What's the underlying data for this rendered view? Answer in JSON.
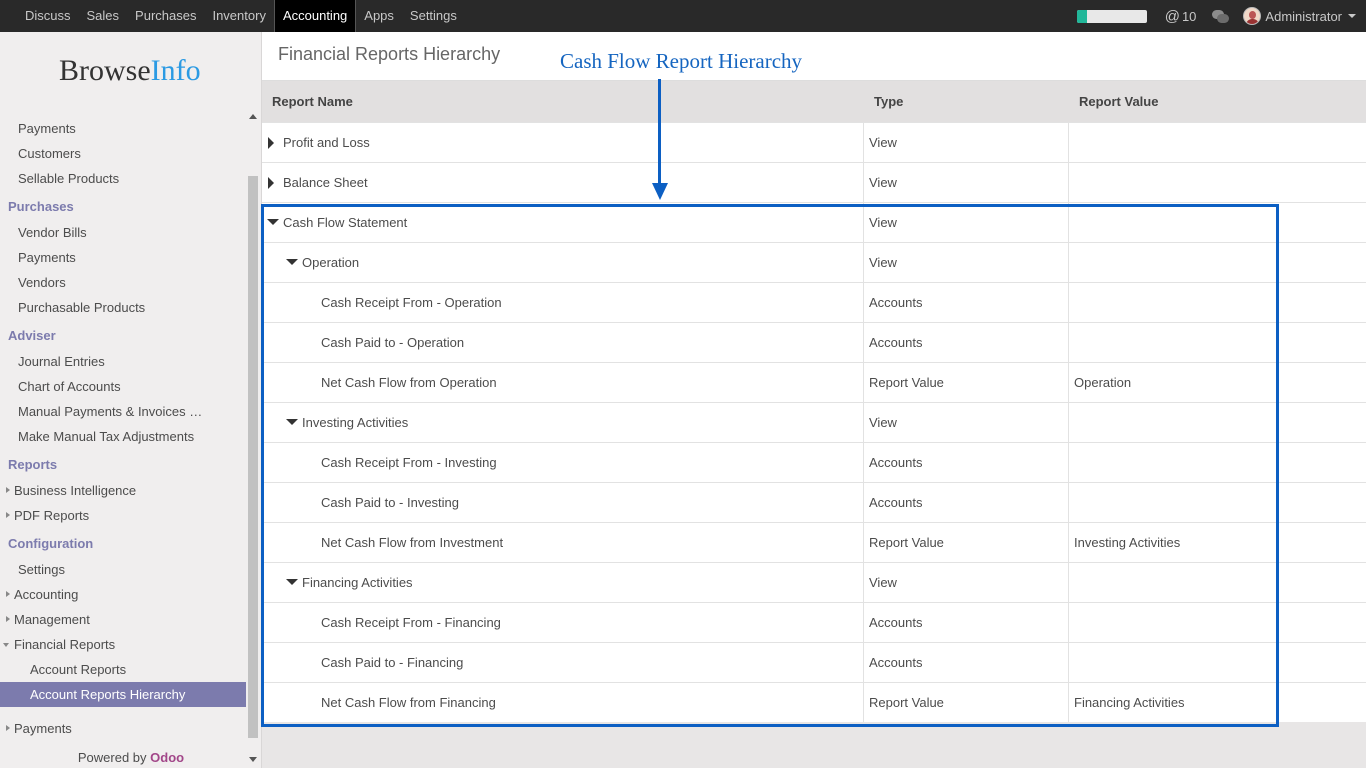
{
  "topbar": {
    "menu": [
      "Discuss",
      "Sales",
      "Purchases",
      "Inventory",
      "Accounting",
      "Apps",
      "Settings"
    ],
    "active": "Accounting",
    "progress_percent": 15,
    "mentions": "10",
    "user": "Administrator",
    "colors": {
      "bg": "#292929",
      "progress": "#21b799"
    }
  },
  "sidebar": {
    "logo_part1": "Browse",
    "logo_part2": "Info",
    "items": [
      {
        "label": "Payments",
        "kind": "item"
      },
      {
        "label": "Customers",
        "kind": "item"
      },
      {
        "label": "Sellable Products",
        "kind": "item"
      },
      {
        "label": "Purchases",
        "kind": "section"
      },
      {
        "label": "Vendor Bills",
        "kind": "item"
      },
      {
        "label": "Payments",
        "kind": "item"
      },
      {
        "label": "Vendors",
        "kind": "item"
      },
      {
        "label": "Purchasable Products",
        "kind": "item"
      },
      {
        "label": "Adviser",
        "kind": "section"
      },
      {
        "label": "Journal Entries",
        "kind": "item"
      },
      {
        "label": "Chart of Accounts",
        "kind": "item"
      },
      {
        "label": "Manual Payments & Invoices …",
        "kind": "item"
      },
      {
        "label": "Make Manual Tax Adjustments",
        "kind": "item"
      },
      {
        "label": "Reports",
        "kind": "section"
      },
      {
        "label": "Business Intelligence",
        "kind": "exp"
      },
      {
        "label": "PDF Reports",
        "kind": "exp"
      },
      {
        "label": "Configuration",
        "kind": "section"
      },
      {
        "label": "Settings",
        "kind": "item"
      },
      {
        "label": "Accounting",
        "kind": "exp"
      },
      {
        "label": "Management",
        "kind": "exp"
      },
      {
        "label": "Financial Reports",
        "kind": "open"
      },
      {
        "label": "Account Reports",
        "kind": "sub"
      },
      {
        "label": "Account Reports Hierarchy",
        "kind": "sub selected"
      }
    ],
    "bottom_item": "Payments",
    "powered_by": "Powered by",
    "odoo": "Odoo",
    "colors": {
      "section": "#7c7bad",
      "selected_bg": "#7c7bad"
    }
  },
  "main": {
    "breadcrumb": "Financial Reports Hierarchy",
    "annotation_title": "Cash Flow Report Hierarchy",
    "annotation_color": "#0c5fc3",
    "columns": [
      "Report Name",
      "Type",
      "Report Value"
    ],
    "rows": [
      {
        "name": "Profit and Loss",
        "type": "View",
        "value": "",
        "level": 0,
        "toggle": "closed"
      },
      {
        "name": "Balance Sheet",
        "type": "View",
        "value": "",
        "level": 0,
        "toggle": "closed"
      },
      {
        "name": "Cash Flow Statement",
        "type": "View",
        "value": "",
        "level": 0,
        "toggle": "open"
      },
      {
        "name": "Operation",
        "type": "View",
        "value": "",
        "level": 1,
        "toggle": "open"
      },
      {
        "name": "Cash Receipt From - Operation",
        "type": "Accounts",
        "value": "",
        "level": 2,
        "toggle": "none"
      },
      {
        "name": "Cash Paid to - Operation",
        "type": "Accounts",
        "value": "",
        "level": 2,
        "toggle": "none"
      },
      {
        "name": "Net Cash Flow from Operation",
        "type": "Report Value",
        "value": "Operation",
        "level": 2,
        "toggle": "none"
      },
      {
        "name": "Investing Activities",
        "type": "View",
        "value": "",
        "level": 1,
        "toggle": "open"
      },
      {
        "name": "Cash Receipt From - Investing",
        "type": "Accounts",
        "value": "",
        "level": 2,
        "toggle": "none"
      },
      {
        "name": "Cash Paid to - Investing",
        "type": "Accounts",
        "value": "",
        "level": 2,
        "toggle": "none"
      },
      {
        "name": "Net Cash Flow from Investment",
        "type": "Report Value",
        "value": "Investing Activities",
        "level": 2,
        "toggle": "none"
      },
      {
        "name": "Financing Activities",
        "type": "View",
        "value": "",
        "level": 1,
        "toggle": "open"
      },
      {
        "name": "Cash Receipt From - Financing",
        "type": "Accounts",
        "value": "",
        "level": 2,
        "toggle": "none"
      },
      {
        "name": "Cash Paid to - Financing",
        "type": "Accounts",
        "value": "",
        "level": 2,
        "toggle": "none"
      },
      {
        "name": "Net Cash Flow from Financing",
        "type": "Report Value",
        "value": "Financing Activities",
        "level": 2,
        "toggle": "none"
      }
    ]
  }
}
